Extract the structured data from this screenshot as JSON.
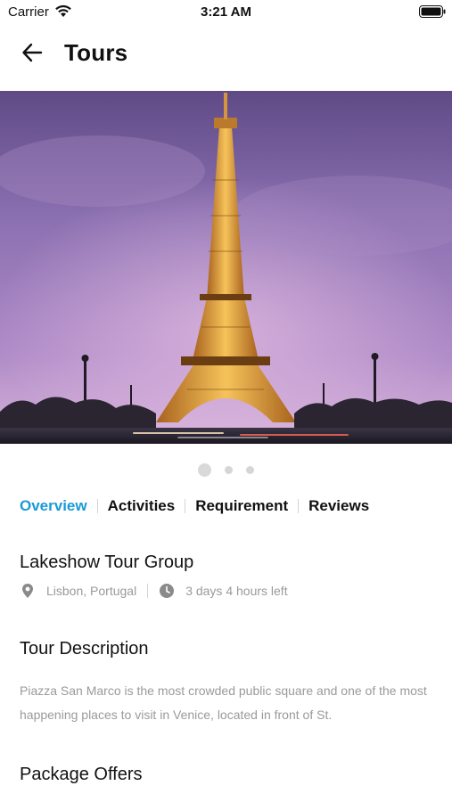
{
  "status_bar": {
    "carrier": "Carrier",
    "time": "3:21 AM",
    "icons": [
      "wifi-icon",
      "battery-icon"
    ]
  },
  "header": {
    "title": "Tours",
    "back_icon": "arrow-left-icon"
  },
  "hero": {
    "subject": "Eiffel Tower at dusk",
    "pager": {
      "count": 3,
      "active_index": 0
    }
  },
  "tabs": [
    {
      "label": "Overview",
      "active": true
    },
    {
      "label": "Activities",
      "active": false
    },
    {
      "label": "Requirement",
      "active": false
    },
    {
      "label": "Reviews",
      "active": false
    }
  ],
  "tour": {
    "name": "Lakeshow Tour Group",
    "location": "Lisbon, Portugal",
    "time_left": "3 days 4 hours left",
    "location_icon": "map-pin-icon",
    "time_icon": "clock-icon"
  },
  "description": {
    "heading": "Tour Description",
    "text": "Piazza San Marco is the most crowded public square and one of the most happening places to visit in Venice, located in front of St."
  },
  "offers": {
    "heading": "Package Offers"
  },
  "colors": {
    "accent": "#1a9ad6",
    "muted_text": "#9a9a9a",
    "sky_top": "#8a6fb0",
    "sky_bottom": "#c8a6d8",
    "tower_light": "#f2b24a"
  }
}
